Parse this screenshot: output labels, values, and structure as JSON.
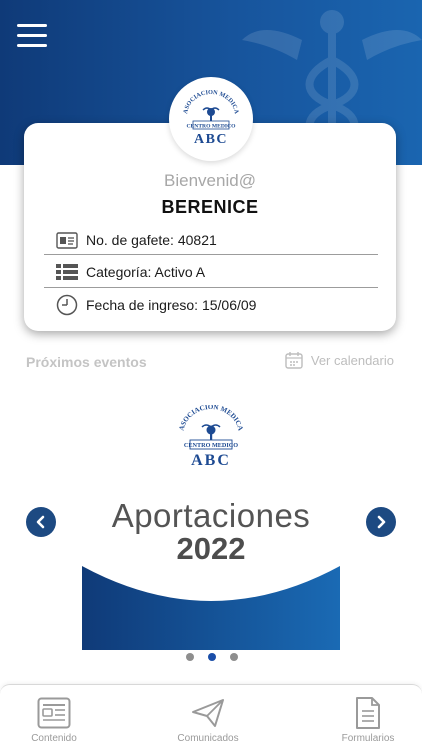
{
  "header": {
    "menu_icon": "hamburger-menu-icon",
    "emblem_icon": "caduceus-icon"
  },
  "logo": {
    "top_text": "ASOCIACION MEDICA",
    "middle_text": "CENTRO MEDICO",
    "bottom_text": "ABC",
    "color": "#1d4a92"
  },
  "profile": {
    "greeting": "Bienvenid@",
    "name": "BERENICE",
    "rows": [
      {
        "icon": "id-card-icon",
        "text": "No. de gafete: 40821"
      },
      {
        "icon": "list-icon",
        "text": "Categoría: Activo A"
      },
      {
        "icon": "clock-icon",
        "text": "Fecha de ingreso: 15/06/09"
      }
    ]
  },
  "events": {
    "title": "Próximos eventos",
    "calendar_link": "Ver calendario",
    "calendar_icon": "calendar-icon"
  },
  "carousel": {
    "slide_title": "Aportaciones",
    "slide_year": "2022",
    "active_index": 1,
    "dot_count": 3,
    "prev_icon": "chevron-left-icon",
    "next_icon": "chevron-right-icon"
  },
  "nav": {
    "items": [
      {
        "label": "Contenido",
        "icon": "newspaper-icon"
      },
      {
        "label": "Comunicados",
        "icon": "paper-plane-icon"
      },
      {
        "label": "Formularios",
        "icon": "document-icon"
      }
    ]
  },
  "colors": {
    "brand_blue": "#17549c",
    "accent_dark": "#1d4a82",
    "dot_active": "#1a4ea8"
  }
}
